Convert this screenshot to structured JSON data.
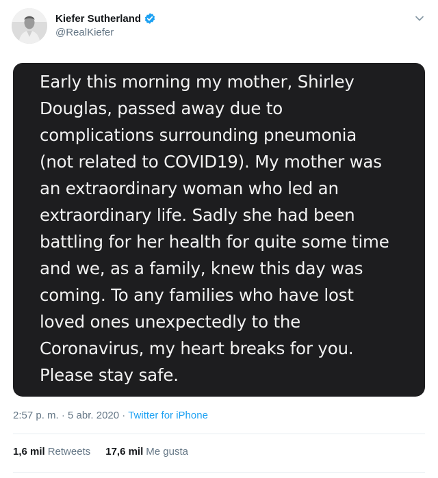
{
  "tweet": {
    "author": {
      "display_name": "Kiefer Sutherland",
      "handle": "@RealKiefer",
      "verified": true
    },
    "media_text": "Early this morning my mother, Shirley\nDouglas, passed away due to\ncomplications surrounding pneumonia\n(not related to COVID19). My mother was\nan extraordinary woman who led an\nextraordinary life. Sadly she had been\nbattling for her health for quite some time\nand we, as a family, knew this day was\ncoming. To any families who have lost\nloved ones unexpectedly to the\nCoronavirus, my heart breaks for you.\nPlease stay safe.",
    "meta": {
      "time": "2:57 p. m.",
      "separator": " · ",
      "date": "5 abr. 2020",
      "source": "Twitter for iPhone"
    },
    "stats": {
      "retweets_count": "1,6 mil",
      "retweets_label": "Retweets",
      "likes_count": "17,6 mil",
      "likes_label": "Me gusta"
    }
  },
  "icons": {
    "verified": "verified-badge-icon",
    "caret": "chevron-down-icon"
  },
  "colors": {
    "accent": "#1da1f2",
    "text_primary": "#14171a",
    "text_secondary": "#657786",
    "media_background": "#1d1d1f",
    "divider": "#e6ecf0"
  }
}
